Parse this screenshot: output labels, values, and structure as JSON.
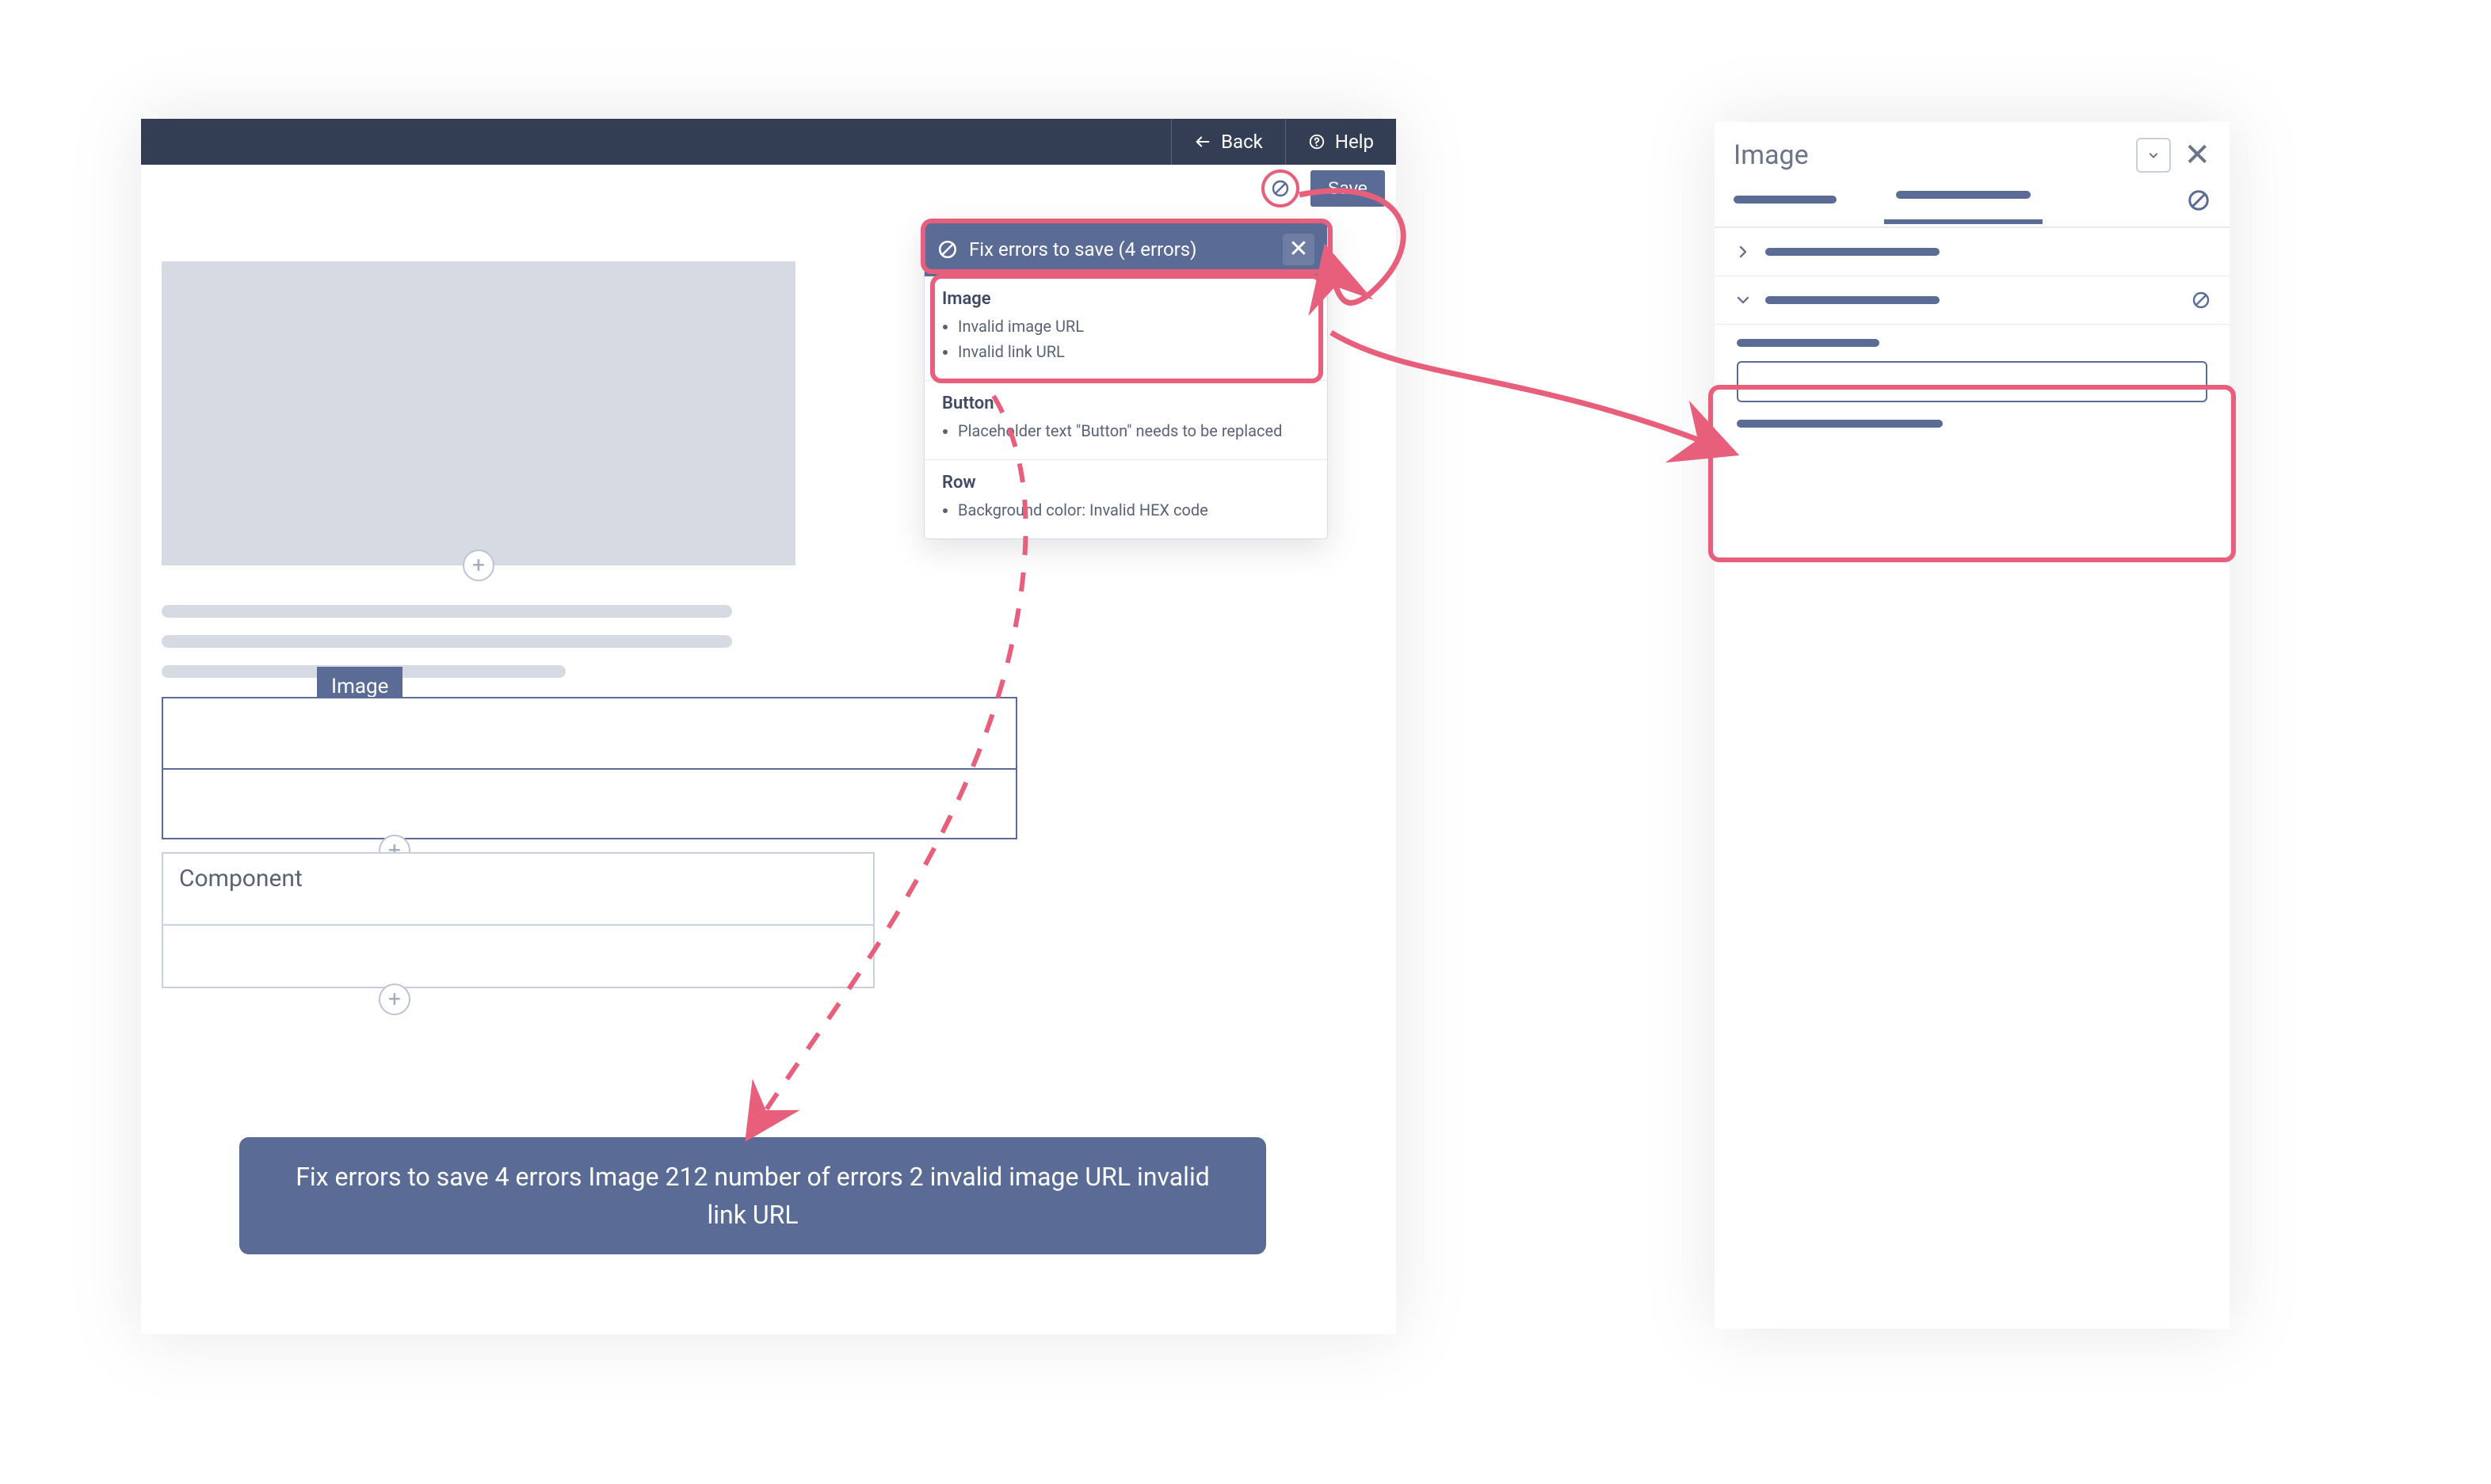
{
  "topbar": {
    "back_label": "Back",
    "help_label": "Help"
  },
  "save": {
    "button_label": "Save"
  },
  "error_popover": {
    "header": "Fix errors to save (4 errors)",
    "sections": [
      {
        "title": "Image",
        "items": [
          "Invalid image URL",
          "Invalid link URL"
        ]
      },
      {
        "title": "Button",
        "items": [
          "Placeholder text \"Button\" needs to be replaced"
        ]
      },
      {
        "title": "Row",
        "items": [
          "Background color: Invalid HEX code"
        ]
      }
    ]
  },
  "canvas": {
    "image_tag": "Image",
    "component_label": "Component"
  },
  "props_panel": {
    "title": "Image"
  },
  "tooltip": {
    "text": "Fix errors to save 4 errors Image 212 number of errors 2 invalid image URL invalid link URL"
  }
}
